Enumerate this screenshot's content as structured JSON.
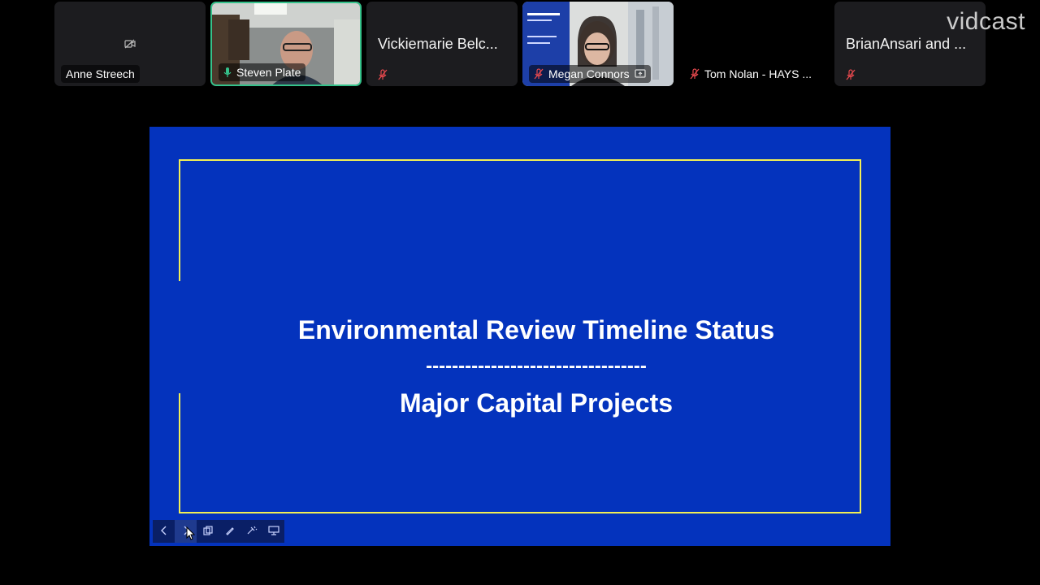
{
  "participants": [
    {
      "name": "Anne Streech",
      "tile_text": "",
      "video": false,
      "camera_off": true,
      "muted": false,
      "speaking": false
    },
    {
      "name": "Steven Plate",
      "tile_text": "",
      "video": true,
      "camera_off": false,
      "muted": false,
      "speaking": true
    },
    {
      "name": "",
      "tile_text": "Vickiemarie Belc...",
      "video": false,
      "camera_off": false,
      "muted": true,
      "speaking": false
    },
    {
      "name": "Megan Connors",
      "tile_text": "",
      "video": true,
      "camera_off": false,
      "muted": true,
      "sharing": true,
      "speaking": false
    },
    {
      "name": "Tom Nolan - HAYS ...",
      "tile_text": "",
      "video": false,
      "camera_off": false,
      "muted": true,
      "speaking": false
    },
    {
      "name": "",
      "tile_text": "BrianAnsari and ...",
      "video": false,
      "camera_off": false,
      "muted": true,
      "speaking": false
    }
  ],
  "watermark": "vidcast",
  "slide": {
    "title": "Environmental Review Timeline Status",
    "divider": "----------------------------------",
    "subtitle": "Major Capital Projects",
    "background_color": "#0433bd",
    "frame_color": "#f2ef55"
  },
  "toolbar": {
    "buttons": [
      {
        "name": "previous-slide",
        "icon": "chevron-left-icon"
      },
      {
        "name": "next-slide",
        "icon": "chevron-right-icon"
      },
      {
        "name": "slide-overview",
        "icon": "copy-icon"
      },
      {
        "name": "annotate",
        "icon": "pen-icon"
      },
      {
        "name": "laser-pointer",
        "icon": "laser-icon"
      },
      {
        "name": "presenter-view",
        "icon": "monitor-icon"
      }
    ]
  },
  "colors": {
    "speaking_border": "#35c28b",
    "muted_icon": "#e5484d"
  }
}
